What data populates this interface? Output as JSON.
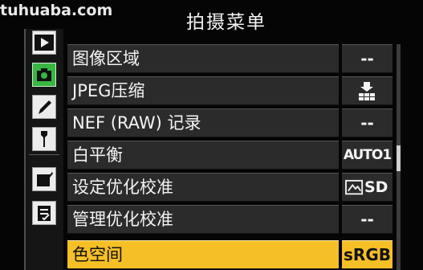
{
  "watermark": "tuhuaba.com",
  "title": "拍摄菜单",
  "sidebar": {
    "tabs": [
      {
        "name": "playback-tab",
        "icon": "play-icon",
        "active": false
      },
      {
        "name": "shooting-tab",
        "icon": "camera-icon",
        "active": true
      },
      {
        "name": "custom-settings-tab",
        "icon": "pencil-icon",
        "active": false
      },
      {
        "name": "setup-tab",
        "icon": "wrench-icon",
        "active": false
      },
      {
        "name": "retouch-tab",
        "icon": "retouch-icon",
        "active": false
      },
      {
        "name": "recent-settings-tab",
        "icon": "recent-settings-icon",
        "active": false
      }
    ]
  },
  "menu": {
    "items": [
      {
        "label": "图像区域",
        "value": "--"
      },
      {
        "label": "JPEG压缩",
        "value_icon": "compression-icon"
      },
      {
        "label": "NEF (RAW) 记录",
        "value": "--"
      },
      {
        "label": "白平衡",
        "value": "AUTO1"
      },
      {
        "label": "设定优化校准",
        "value": "SD",
        "value_icon": "picture-control-icon"
      },
      {
        "label": "管理优化校准",
        "value": "--"
      },
      {
        "label": "色空间",
        "value": "sRGB",
        "selected": true
      }
    ]
  },
  "scrollbar": {
    "position_fraction": 0.45,
    "visible_fraction": 0.45
  },
  "colors": {
    "selected": "#f5bf26",
    "active_tab": "#37b742",
    "row": "#2b2b2b"
  }
}
